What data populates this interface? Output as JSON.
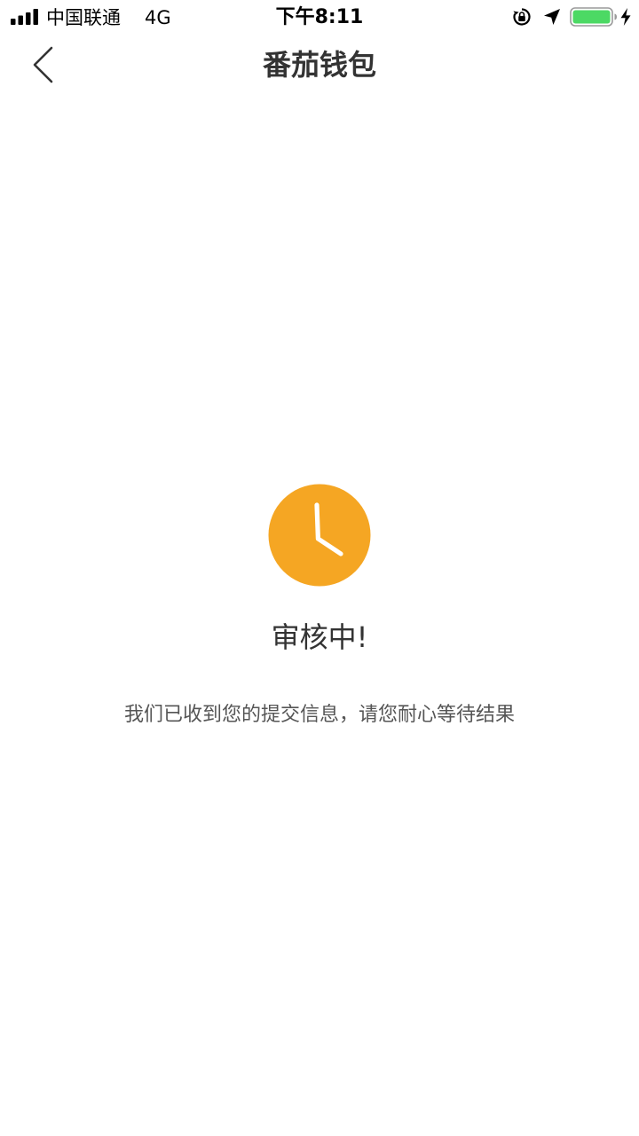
{
  "status_bar": {
    "carrier": "中国联通",
    "network": "4G",
    "time": "下午8:11",
    "icons": {
      "signal": "signal-bars-icon",
      "orientation_lock": "orientation-lock-icon",
      "location": "location-arrow-icon",
      "battery": "battery-icon",
      "charging": "charging-bolt-icon"
    },
    "battery_level": 1.0,
    "battery_color": "#4cd964"
  },
  "nav": {
    "title": "番茄钱包",
    "back_icon": "chevron-left-icon"
  },
  "main": {
    "status_icon": "clock-icon",
    "accent_color": "#f5a623",
    "status_title": "审核中!",
    "status_description": "我们已收到您的提交信息，请您耐心等待结果"
  }
}
